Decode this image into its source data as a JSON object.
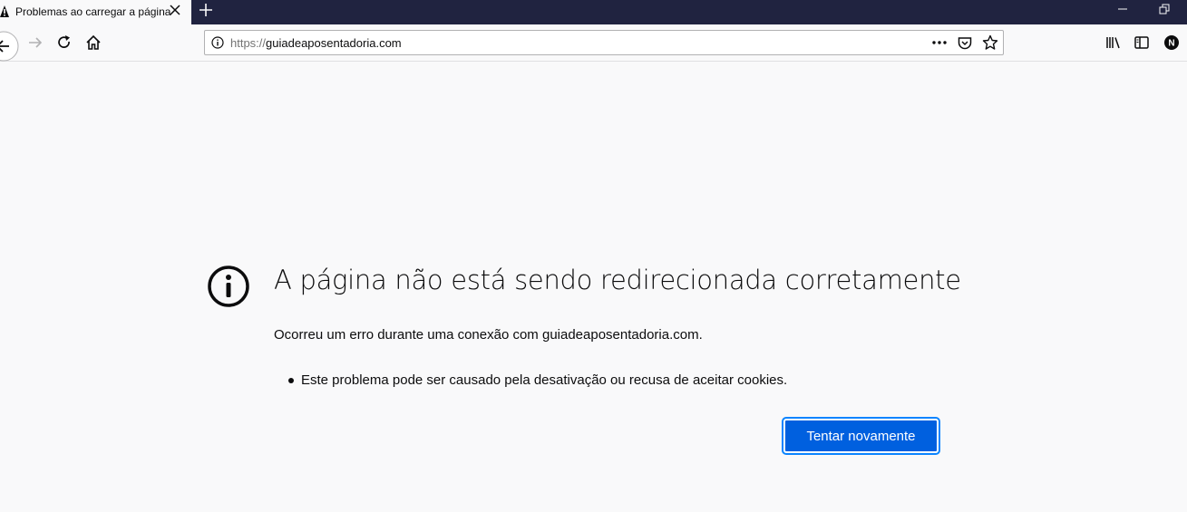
{
  "tab": {
    "title": "Problemas ao carregar a página"
  },
  "urlbar": {
    "scheme": "https://",
    "host": "guiadeaposentadoria.com"
  },
  "error": {
    "title": "A página não está sendo redirecionada corretamente",
    "description": "Ocorreu um erro durante uma conexão com guiadeaposentadoria.com.",
    "bullets": [
      "Este problema pode ser causado pela desativação ou recusa de aceitar cookies."
    ],
    "retry_label": "Tentar novamente"
  },
  "account": {
    "initial": "N"
  },
  "colors": {
    "tabstrip": "#202340",
    "accent": "#0060df",
    "page_bg": "#f9f9fa"
  }
}
